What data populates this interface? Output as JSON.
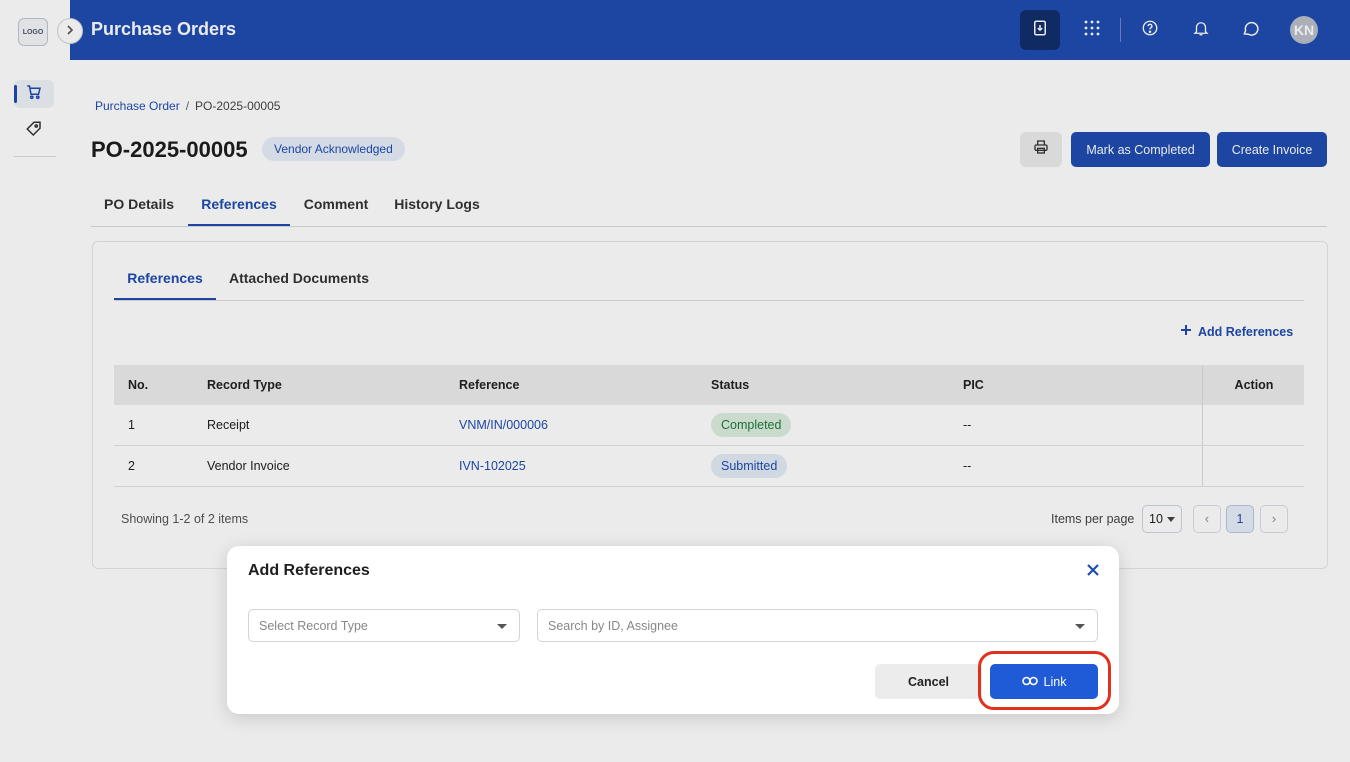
{
  "sidebar": {
    "logo_text": "LOGO",
    "items": [
      {
        "name": "cart-icon"
      },
      {
        "name": "tag-icon"
      }
    ]
  },
  "header": {
    "title": "Purchase Orders",
    "avatar_initials": "KN",
    "icons": [
      "download-icon",
      "apps-grid-icon",
      "help-icon",
      "bell-icon",
      "chat-icon"
    ]
  },
  "breadcrumb": {
    "parent": "Purchase Order",
    "separator": "/",
    "current": "PO-2025-00005"
  },
  "po": {
    "number": "PO-2025-00005",
    "status": "Vendor Acknowledged"
  },
  "actions": {
    "mark_completed": "Mark as Completed",
    "create_invoice": "Create Invoice"
  },
  "tabs": [
    {
      "label": "PO Details"
    },
    {
      "label": "References",
      "active": true
    },
    {
      "label": "Comment"
    },
    {
      "label": "History Logs"
    }
  ],
  "subtabs": [
    {
      "label": "References",
      "active": true
    },
    {
      "label": "Attached Documents"
    }
  ],
  "add_references_label": "Add References",
  "table": {
    "headers": [
      "No.",
      "Record Type",
      "Reference",
      "Status",
      "PIC",
      "Action"
    ],
    "rows": [
      {
        "no": "1",
        "record_type": "Receipt",
        "reference": "VNM/IN/000006",
        "status": "Completed",
        "pic": "--"
      },
      {
        "no": "2",
        "record_type": "Vendor Invoice",
        "reference": "IVN-102025",
        "status": "Submitted",
        "pic": "--"
      }
    ]
  },
  "pagination": {
    "showing": "Showing 1-2 of 2 items",
    "items_per_page_label": "Items per page",
    "items_per_page": "10",
    "current_page": "1",
    "prev": "‹",
    "next": "›"
  },
  "modal": {
    "title": "Add References",
    "record_type_placeholder": "Select Record Type",
    "search_placeholder": "Search by ID, Assignee",
    "cancel_label": "Cancel",
    "link_label": "Link"
  },
  "colors": {
    "primary": "#1f4cb0",
    "link_button": "#1f5bd6",
    "highlight_ring": "#e0311f",
    "completed_bg": "#dceee0",
    "submitted_bg": "#e2ebf6"
  }
}
